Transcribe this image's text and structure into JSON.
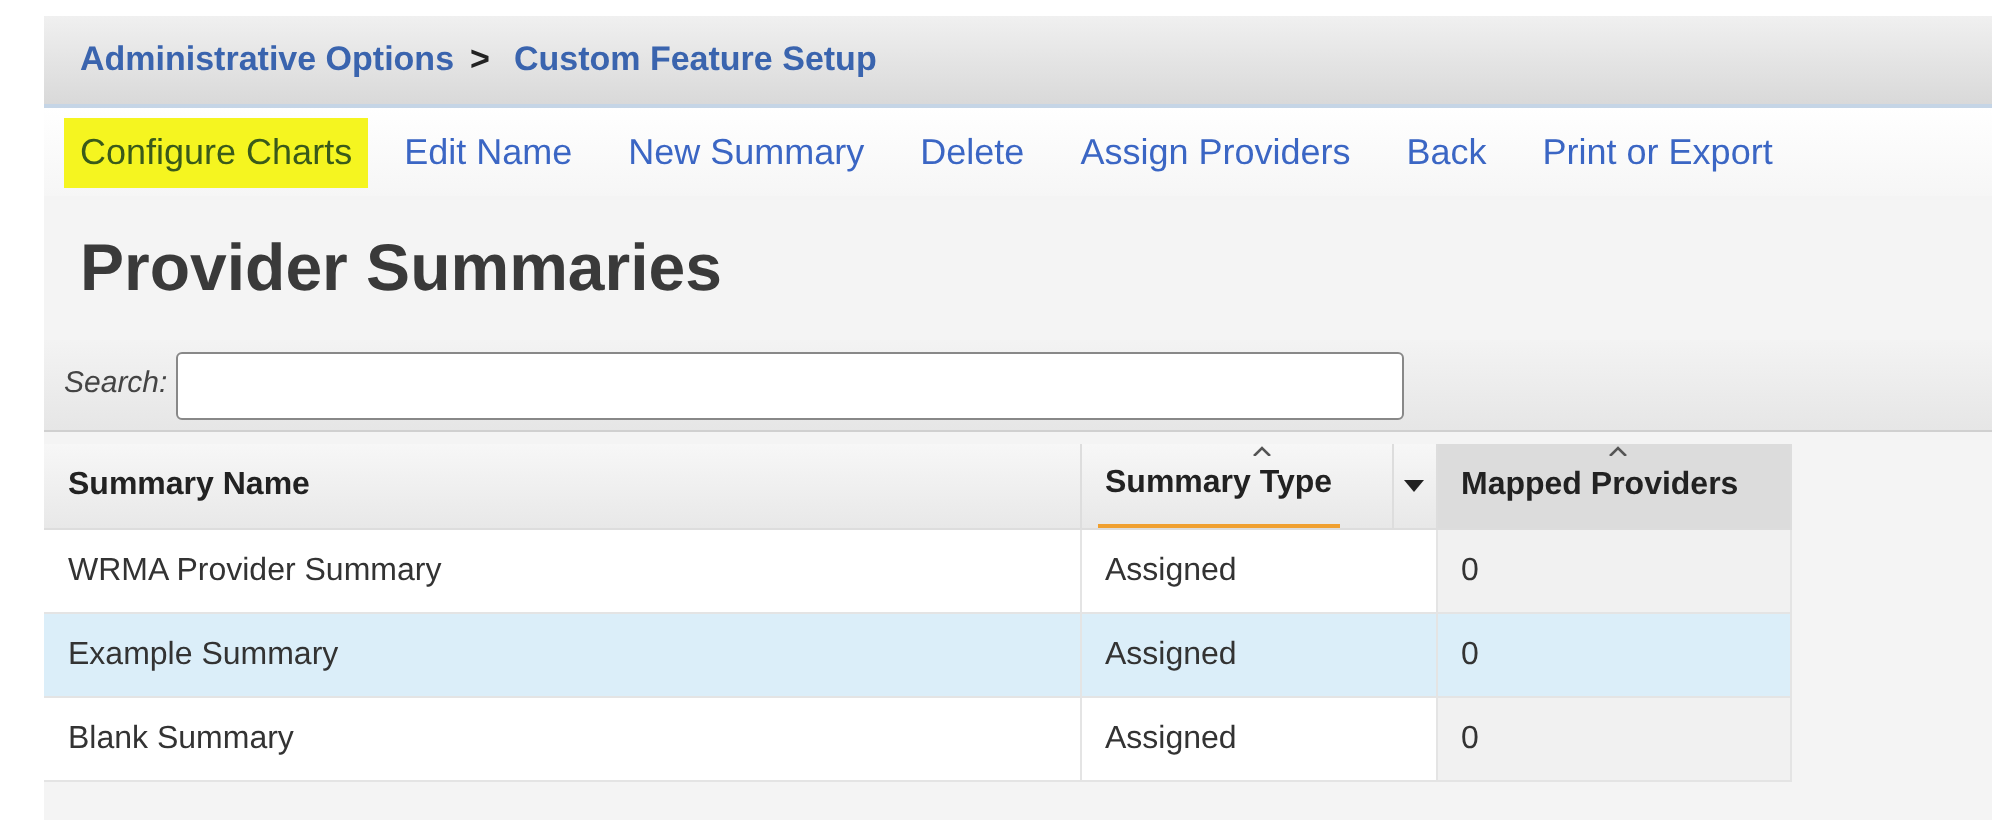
{
  "breadcrumb": [
    {
      "label": "Administrative Options"
    },
    {
      "label": "Custom Feature Setup"
    }
  ],
  "breadcrumb_separator": ">",
  "toolbar": [
    {
      "label": "Configure Charts",
      "highlighted": true
    },
    {
      "label": "Edit Name",
      "highlighted": false
    },
    {
      "label": "New Summary",
      "highlighted": false
    },
    {
      "label": "Delete",
      "highlighted": false
    },
    {
      "label": "Assign Providers",
      "highlighted": false
    },
    {
      "label": "Back",
      "highlighted": false
    },
    {
      "label": "Print or Export",
      "highlighted": false
    }
  ],
  "title": "Provider Summaries",
  "search": {
    "label": "Search:"
  },
  "table": {
    "columns": [
      {
        "label": "Summary Name",
        "sortable": false,
        "sorted": false,
        "shaded": false
      },
      {
        "label": "Summary Type",
        "sortable": true,
        "sorted": true,
        "shaded": false
      },
      {
        "label": "Mapped Providers",
        "sortable": true,
        "sorted": false,
        "shaded": true
      }
    ],
    "rows": [
      {
        "cells": [
          "WRMA Provider Summary",
          "Assigned",
          "0"
        ],
        "selected": false
      },
      {
        "cells": [
          "Example Summary",
          "Assigned",
          "0"
        ],
        "selected": true
      },
      {
        "cells": [
          "Blank Summary",
          "Assigned",
          "0"
        ],
        "selected": false
      }
    ]
  }
}
